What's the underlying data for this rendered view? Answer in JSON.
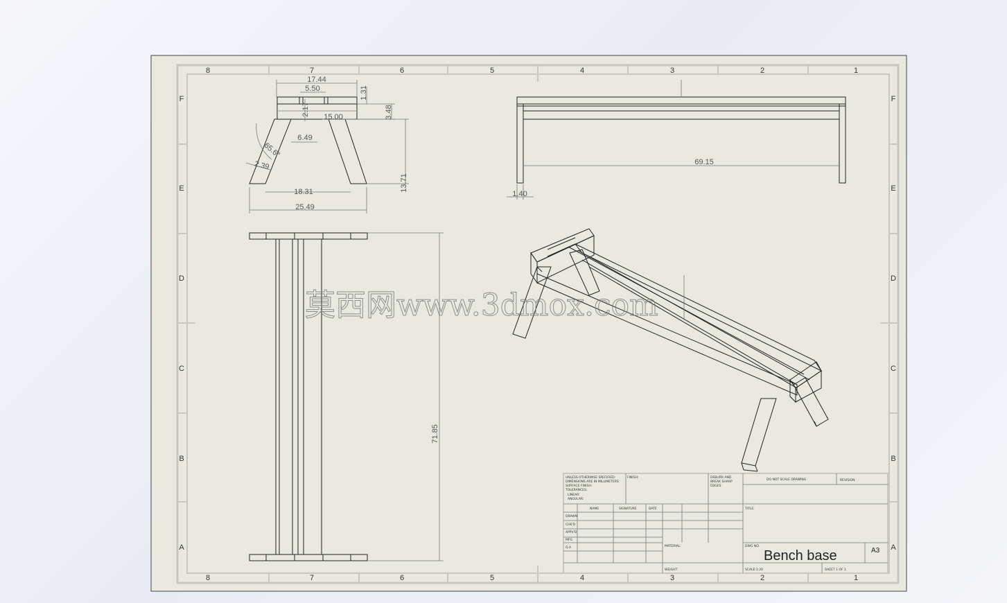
{
  "sheet": {
    "zones_top": [
      "8",
      "7",
      "6",
      "5",
      "4",
      "3",
      "2",
      "1"
    ],
    "zones_side": [
      "F",
      "E",
      "D",
      "C",
      "B",
      "A"
    ],
    "colors": {
      "paper": "#e9e9df",
      "line": "#222222",
      "dim": "#666666",
      "frame": "#c9c9c0"
    }
  },
  "dimensions": {
    "front": [
      "17.44",
      "5.50",
      "1.31",
      "2.17",
      "3.48",
      "15.00",
      "6.49",
      "65.6°",
      "2.39",
      "18.31",
      "13.71",
      "25.49"
    ],
    "side": [
      "69.15",
      "1.40"
    ],
    "top": [
      "71.85"
    ]
  },
  "watermark": "莫西网www.3dmox.com",
  "title_block": {
    "notes": [
      "UNLESS OTHERWISE SPECIFIED:",
      "DIMENSIONS ARE IN MILLIMETERS",
      "SURFACE FINISH:",
      "TOLERANCES:",
      "LINEAR:",
      "ANGULAR:"
    ],
    "finish_label": "FINISH:",
    "deburr": [
      "DEBURR AND",
      "BREAK SHARP",
      "EDGES"
    ],
    "do_not_scale": "DO NOT SCALE DRAWING",
    "revision": "REVISION",
    "col_headers": [
      "NAME",
      "SIGNATURE",
      "DATE"
    ],
    "row_labels": [
      "DRAWN",
      "CHK'D",
      "APPV'D",
      "MFG",
      "Q.A"
    ],
    "material": "MATERIAL:",
    "weight": "WEIGHT:",
    "title_label": "TITLE:",
    "dwg_no_label": "DWG NO.",
    "drawing_title": "Bench base",
    "sheet_size": "A3",
    "scale": "SCALE:1:20",
    "sheet_no": "SHEET 1 OF 1"
  }
}
